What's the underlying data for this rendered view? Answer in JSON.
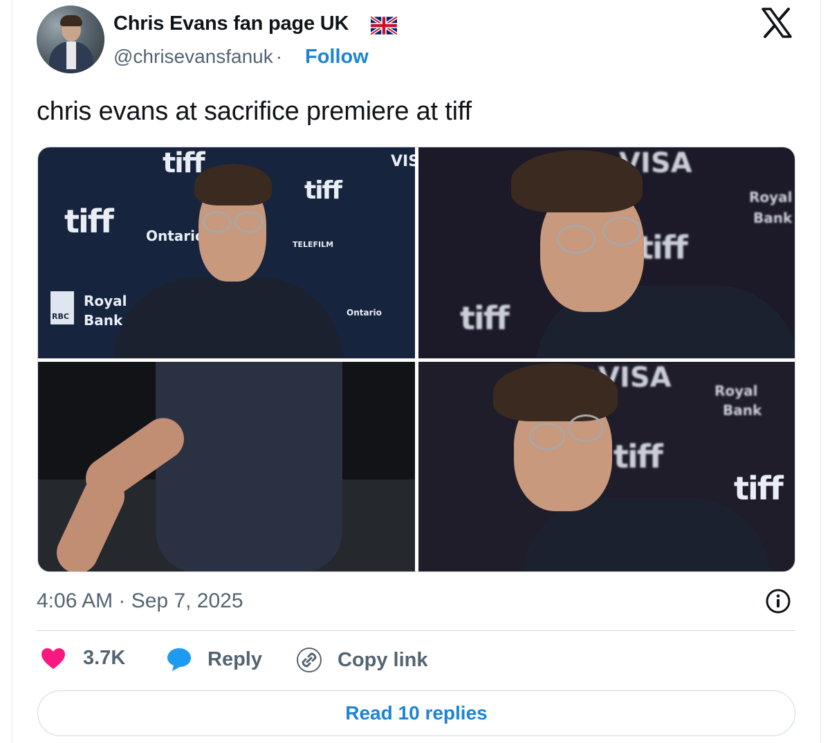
{
  "author": {
    "name": "Chris Evans fan page UK",
    "flag_icon": "uk-flag-icon",
    "handle": "@chrisevansfanuk",
    "separator": "·",
    "follow_label": "Follow"
  },
  "platform_icon": "x-logo-icon",
  "tweet": {
    "text": "chris evans at sacrifice premiere at tiff",
    "timestamp": "4:06 AM · Sep 7, 2025",
    "info_icon": "info-icon"
  },
  "photos": {
    "p1": {
      "watermarks": [
        "tiff",
        "tiff",
        "Ontario",
        "Royal",
        "Bank",
        "RBC",
        "tiff",
        "TELEFILM",
        "Ontario",
        "VISA"
      ]
    },
    "p2": {
      "watermarks": [
        "VISA",
        "tiff",
        "Royal",
        "Bank",
        "tiff"
      ]
    },
    "p4": {
      "watermarks": [
        "VISA",
        "tiff",
        "Royal",
        "Bank",
        "tiff"
      ]
    }
  },
  "actions": {
    "like_icon": "heart-icon",
    "like_count": "3.7K",
    "reply_icon": "reply-bubble-icon",
    "reply_label": "Reply",
    "copy_icon": "link-icon",
    "copy_label": "Copy link"
  },
  "read_replies_label": "Read 10 replies",
  "colors": {
    "link_blue": "#1d84d4",
    "heart_pink": "#f91880",
    "reply_blue": "#1d9bf0",
    "secondary_text": "#536471"
  }
}
